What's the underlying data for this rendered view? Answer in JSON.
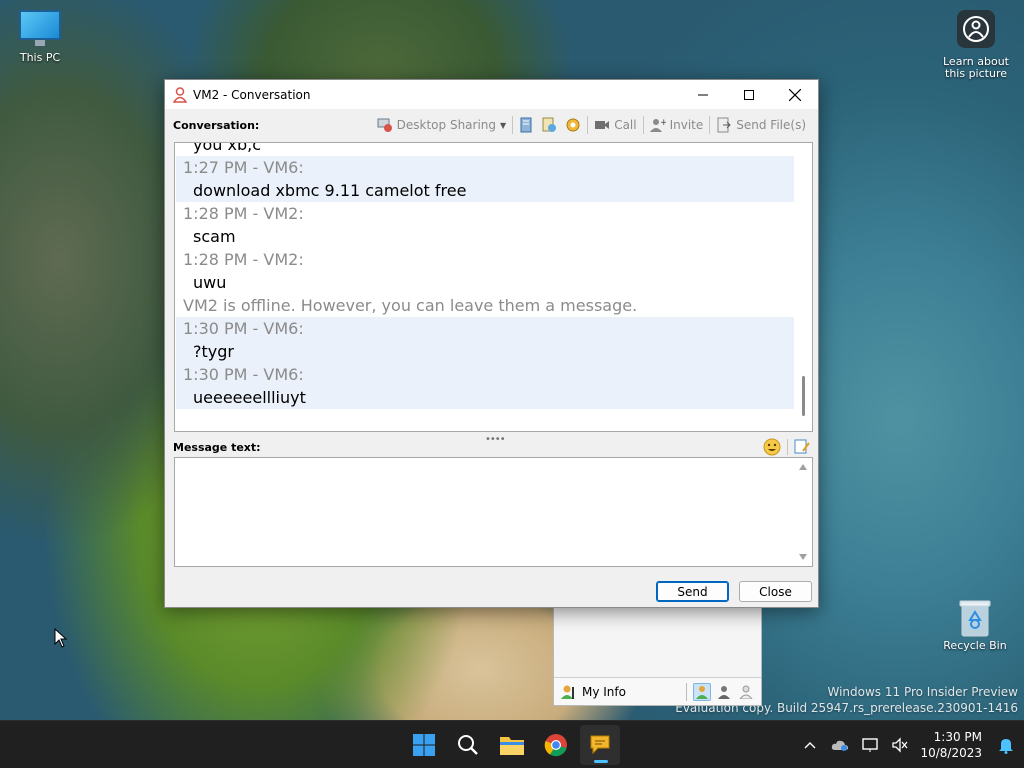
{
  "desktop": {
    "icons": {
      "this_pc": "This PC",
      "learn": "Learn about this picture",
      "recycle_bin": "Recycle Bin"
    },
    "watermark": {
      "line1": "Windows 11 Pro Insider Preview",
      "line2": "Evaluation copy. Build 25947.rs_prerelease.230901-1416"
    }
  },
  "window": {
    "title": "VM2 - Conversation",
    "conversation_label": "Conversation:",
    "toolbar": {
      "desktop_sharing": "Desktop Sharing",
      "call": "Call",
      "invite": "Invite",
      "send_files": "Send File(s)"
    },
    "messages": [
      {
        "kind": "partial",
        "body": "you xb,c"
      },
      {
        "kind": "vm6",
        "head": "1:27 PM - VM6:",
        "body": "download xbmc 9.11 camelot free"
      },
      {
        "kind": "vm2",
        "head": "1:28 PM - VM2:",
        "body": "scam"
      },
      {
        "kind": "vm2",
        "head": "1:28 PM - VM2:",
        "body": "uwu"
      },
      {
        "kind": "system",
        "text": "VM2 is offline. However, you can leave them a message."
      },
      {
        "kind": "vm6",
        "head": "1:30 PM - VM6:",
        "body": "?tygr"
      },
      {
        "kind": "vm6",
        "head": "1:30 PM - VM6:",
        "body": "ueeeeeellliuyt"
      }
    ],
    "message_text_label": "Message text:",
    "input_value": "",
    "buttons": {
      "send": "Send",
      "close": "Close"
    }
  },
  "buddy_list": {
    "my_info": "My Info"
  },
  "taskbar": {
    "time": "1:30 PM",
    "date": "10/8/2023"
  },
  "colors": {
    "accent": "#0067c0",
    "vm6_bg": "#eaf1fb",
    "header_gray": "#8b8b8b",
    "taskbar": "#202020"
  }
}
